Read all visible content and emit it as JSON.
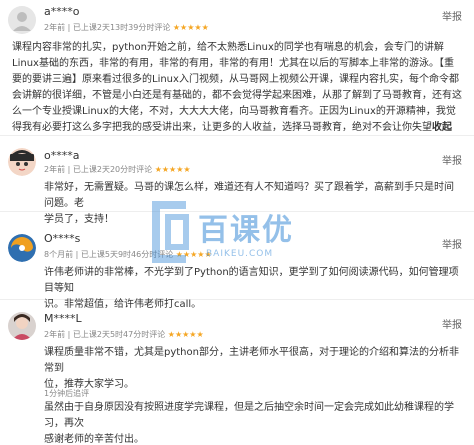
{
  "reviews": [
    {
      "user": "a****o",
      "meta_prefix": "2年前 | 已上课2天13时39分时评论",
      "stars": "★★★★★",
      "report": "举报",
      "lines": [
        "课程内容非常的扎实，python开始之前，给不太熟悉Linux的同学也有喘息的机会，会专门的讲解",
        "Linux基础的东西，非常的有用，非常的有用，非常的有用！尤其在以后的写脚本上非常的游泳。【重",
        "要的要讲三遍】原来看过很多的Linux入门视频，从马哥网上视频公开课，课程内容扎实，每个命令都",
        "会讲解的很详细，不管是小白还是有基础的，都不会觉得学起来困难，从那了解到了马哥教育，还有这",
        "么一个专业授课Linux的大佬，不对，大大大大佬，向马哥教育看齐。正因为Linux的开源精神，我觉",
        "得我有必要打这么多字把我的感受讲出来，让更多的人收益，选择马哥教育，绝对不会让你失望",
        "收起"
      ]
    },
    {
      "user": "o****a",
      "meta_prefix": "2年前 | 已上课2天20分时评论",
      "stars": "★★★★★",
      "report": "举报",
      "lines": [
        "非常好，无需置疑。马哥的课怎么样，难道还有人不知道吗？买了跟着学，高薪到手只是时间问题。老",
        "学员了，支持！"
      ]
    },
    {
      "user": "O****s",
      "meta_prefix": "8个月前 | 已上课5天9时46分时评论",
      "stars": "★★★★★",
      "report": "举报",
      "lines": [
        "许伟老师讲的非常棒，不光学到了Python的语言知识，更学到了如何阅读源代码，如何管理项目等知",
        "识。非常超值，给许伟老师打call。"
      ]
    },
    {
      "user": "M****L",
      "meta_prefix": "2年前 | 已上课2天5时47分时评论",
      "stars": "★★★★★",
      "report": "举报",
      "lines": [
        "课程质量非常不错，尤其是python部分，主讲老师水平很高，对于理论的介绍和算法的分析非常到",
        "位，推荐大家学习。"
      ]
    }
  ],
  "followup": {
    "meta": "1分钟后追评",
    "lines": [
      "虽然由于自身原因没有按照进度学完课程，但是之后抽空余时间一定会完成如此幼稚课程的学习，再次",
      "感谢老师的辛苦付出。"
    ]
  },
  "watermark": {
    "title": "百课优",
    "subtitle": "BAIKEU.COM"
  },
  "colors": {
    "star": "#f5a623",
    "watermark": "#3c8cd7"
  }
}
